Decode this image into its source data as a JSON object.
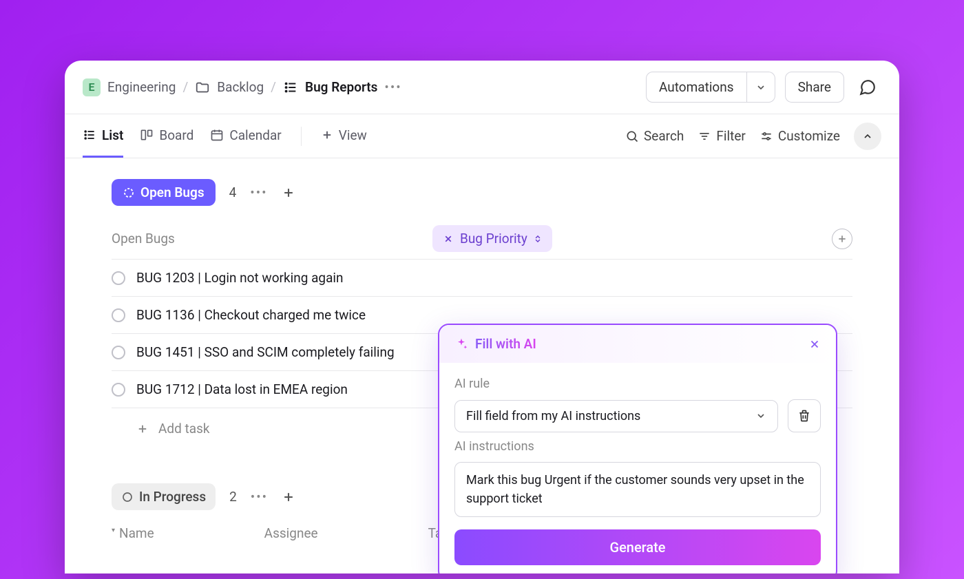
{
  "breadcrumb": {
    "workspace_badge": "E",
    "workspace": "Engineering",
    "folder": "Backlog",
    "list": "Bug Reports"
  },
  "header": {
    "automations": "Automations",
    "share": "Share"
  },
  "views": {
    "list": "List",
    "board": "Board",
    "calendar": "Calendar",
    "add": "View"
  },
  "toolbar": {
    "search": "Search",
    "filter": "Filter",
    "customize": "Customize"
  },
  "group_open": {
    "label": "Open Bugs",
    "count": "4"
  },
  "columns": {
    "name": "Open Bugs",
    "priority": "Bug Priority"
  },
  "tasks": [
    {
      "title": "BUG 1203 | Login not working again"
    },
    {
      "title": "BUG 1136 | Checkout charged me twice"
    },
    {
      "title": "BUG 1451 | SSO and SCIM completely failing"
    },
    {
      "title": "BUG 1712 | Data lost in EMEA region"
    }
  ],
  "add_task": "Add task",
  "group_inprogress": {
    "label": "In Progress",
    "count": "2"
  },
  "cols2": {
    "name": "Name",
    "assignee": "Assignee",
    "tags": "Ta"
  },
  "ai": {
    "title": "Fill with AI",
    "rule_label": "AI rule",
    "rule_value": "Fill field from my AI instructions",
    "instructions_label": "AI instructions",
    "instructions_value": "Mark this bug Urgent if the customer sounds very upset in the support ticket",
    "generate": "Generate"
  }
}
